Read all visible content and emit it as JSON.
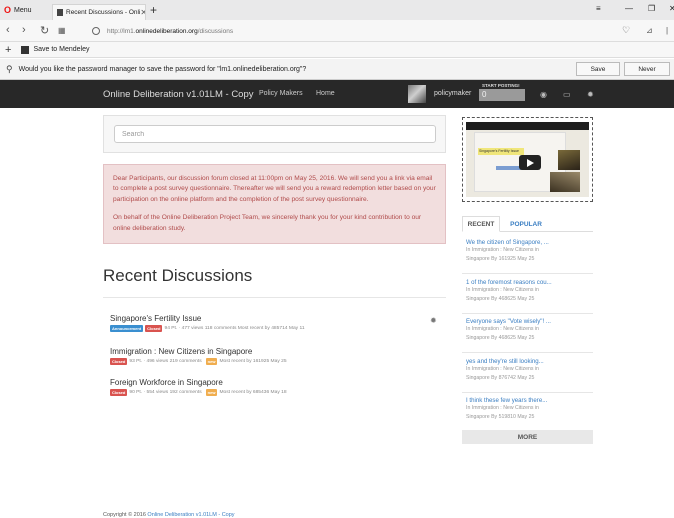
{
  "browser": {
    "menu_label": "Menu",
    "tab_title": "Recent Discussions - Onli",
    "url_prefix": "http://lm1.",
    "url_domain": "onlinedeliberation.org",
    "url_path": "/discussions",
    "bookmark": "Save to Mendeley",
    "password_prompt": "Would you like the password manager to save the password for \"lm1.onlinedeliberation.org\"?",
    "save_label": "Save",
    "never_label": "Never"
  },
  "site": {
    "brand": "Online Deliberation v1.01LM - Copy",
    "nav": [
      "Policy Makers",
      "Home"
    ],
    "username": "policymaker",
    "start_posting_label": "START POSTING!",
    "start_posting_value": "0",
    "accent": "#3a7ec2"
  },
  "search": {
    "placeholder": "Search"
  },
  "alert": {
    "p1": "Dear Participants, our discussion forum closed at 11:00pm on May 25, 2016. We will send you a link via email to complete a post survey questionnaire. Thereafter we will send you a reward redemption letter based on your participation on the online platform and the completion of the post survey questionnaire.",
    "p2": "On behalf of the Online Deliberation Project Team, we sincerely thank you for your kind contribution to our online deliberation study."
  },
  "main": {
    "title": "Recent Discussions",
    "discussions": [
      {
        "title": "Singapore's Fertility Issue",
        "badge1": "Announcement",
        "badge2": "Closed",
        "stats": "94 Pt. · 477 views   118 comments   Most recent by 485714   May 11"
      },
      {
        "title": "Immigration : New Citizens in Singapore",
        "badge1": "Closed",
        "stats1": "93 Pt. · 496 views   219 comments",
        "badge2": "new",
        "stats2": "Most recent by 161925   May 25"
      },
      {
        "title": "Foreign Workforce in Singapore",
        "badge1": "Closed",
        "stats1": "90 Pt. · 554 views   192 comments",
        "badge2": "new",
        "stats2": "Most recent by 685436   May 18"
      }
    ]
  },
  "sidebar": {
    "video_caption": "Singapore's Fertility Issue",
    "tabs": [
      "RECENT",
      "POPULAR"
    ],
    "items": [
      {
        "title": "We the citizen of Singapore, ...",
        "line1": "In Immigration : New Citizens in",
        "line2": "Singapore   By 161925   May 25"
      },
      {
        "title": "1 of the foremost reasons cou...",
        "line1": "In Immigration : New Citizens in",
        "line2": "Singapore   By 468625   May 25"
      },
      {
        "title": "Everyone says \"Vote wisely\"! ...",
        "line1": "In Immigration : New Citizens in",
        "line2": "Singapore   By 468625   May 25"
      },
      {
        "title": "yes and they're still looking...",
        "line1": "In Immigration : New Citizens in",
        "line2": "Singapore   By 876742   May 25"
      },
      {
        "title": "I think these few years there...",
        "line1": "In Immigration : New Citizens in",
        "line2": "Singapore   By 519810   May 25"
      }
    ],
    "more": "MORE"
  },
  "footer": {
    "prefix": "Copyright © 2016 ",
    "link": "Online Deliberation v1.01LM - Copy"
  }
}
